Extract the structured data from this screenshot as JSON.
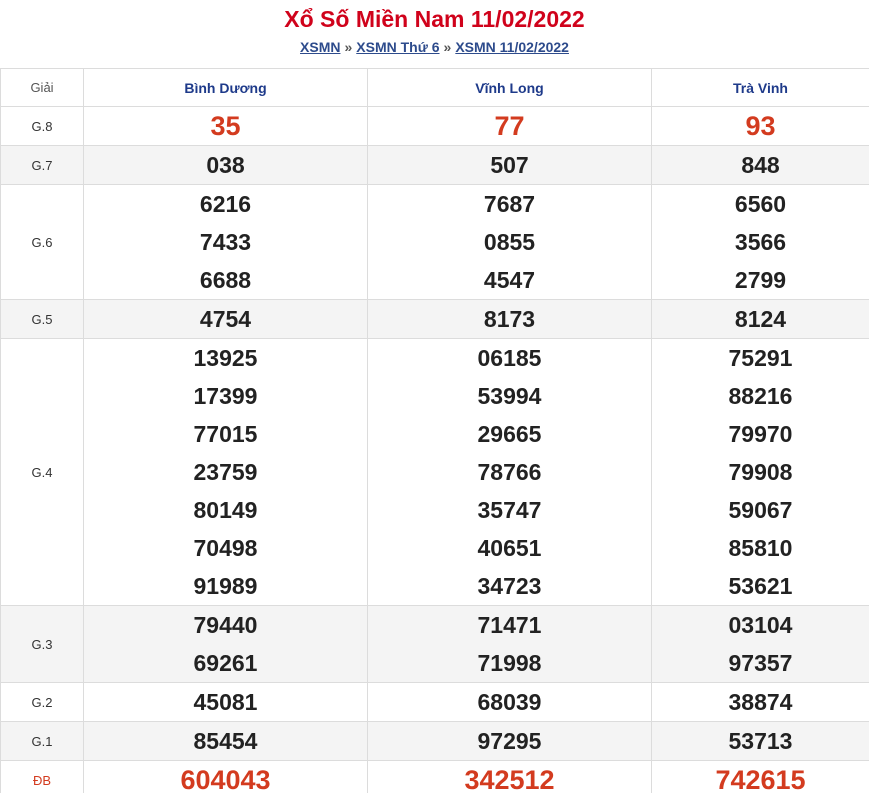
{
  "header": {
    "title": "Xổ Số Miền Nam 11/02/2022",
    "breadcrumb": [
      {
        "label": "XSMN"
      },
      {
        "label": "XSMN Thứ 6"
      },
      {
        "label": "XSMN 11/02/2022"
      }
    ],
    "separator": "»"
  },
  "table": {
    "label_header": "Giải",
    "provinces": [
      "Bình Dương",
      "Vĩnh Long",
      "Trà Vinh"
    ],
    "rows": [
      {
        "label": "G.8",
        "highlight": true,
        "values": [
          [
            "35"
          ],
          [
            "77"
          ],
          [
            "93"
          ]
        ]
      },
      {
        "label": "G.7",
        "values": [
          [
            "038"
          ],
          [
            "507"
          ],
          [
            "848"
          ]
        ]
      },
      {
        "label": "G.6",
        "values": [
          [
            "6216",
            "7433",
            "6688"
          ],
          [
            "7687",
            "0855",
            "4547"
          ],
          [
            "6560",
            "3566",
            "2799"
          ]
        ]
      },
      {
        "label": "G.5",
        "values": [
          [
            "4754"
          ],
          [
            "8173"
          ],
          [
            "8124"
          ]
        ]
      },
      {
        "label": "G.4",
        "values": [
          [
            "13925",
            "17399",
            "77015",
            "23759",
            "80149",
            "70498",
            "91989"
          ],
          [
            "06185",
            "53994",
            "29665",
            "78766",
            "35747",
            "40651",
            "34723"
          ],
          [
            "75291",
            "88216",
            "79970",
            "79908",
            "59067",
            "85810",
            "53621"
          ]
        ]
      },
      {
        "label": "G.3",
        "values": [
          [
            "79440",
            "69261"
          ],
          [
            "71471",
            "71998"
          ],
          [
            "03104",
            "97357"
          ]
        ]
      },
      {
        "label": "G.2",
        "values": [
          [
            "45081"
          ],
          [
            "68039"
          ],
          [
            "38874"
          ]
        ]
      },
      {
        "label": "G.1",
        "values": [
          [
            "85454"
          ],
          [
            "97295"
          ],
          [
            "53713"
          ]
        ]
      },
      {
        "label": "ĐB",
        "highlight": true,
        "special": true,
        "values": [
          [
            "604043"
          ],
          [
            "342512"
          ],
          [
            "742615"
          ]
        ]
      }
    ]
  },
  "colors": {
    "title": "#d0021b",
    "link": "#2d4b8c",
    "province": "#1e3a8a",
    "highlight_number": "#d33b1f",
    "alt_row": "#f4f4f4"
  }
}
